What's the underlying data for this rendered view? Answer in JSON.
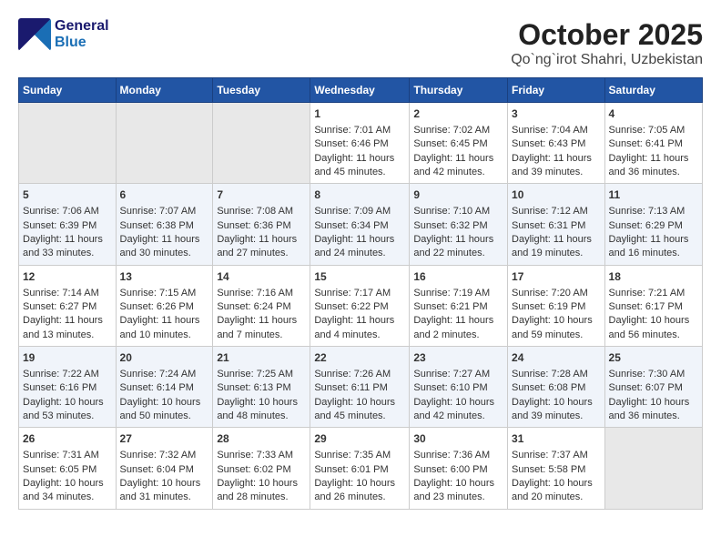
{
  "header": {
    "logo_general": "General",
    "logo_blue": "Blue",
    "title": "October 2025",
    "subtitle": "Qo`ng`irot Shahri, Uzbekistan"
  },
  "days_of_week": [
    "Sunday",
    "Monday",
    "Tuesday",
    "Wednesday",
    "Thursday",
    "Friday",
    "Saturday"
  ],
  "weeks": [
    [
      {
        "day": "",
        "empty": true
      },
      {
        "day": "",
        "empty": true
      },
      {
        "day": "",
        "empty": true
      },
      {
        "day": "1",
        "sunrise": "7:01 AM",
        "sunset": "6:46 PM",
        "daylight": "11 hours and 45 minutes."
      },
      {
        "day": "2",
        "sunrise": "7:02 AM",
        "sunset": "6:45 PM",
        "daylight": "11 hours and 42 minutes."
      },
      {
        "day": "3",
        "sunrise": "7:04 AM",
        "sunset": "6:43 PM",
        "daylight": "11 hours and 39 minutes."
      },
      {
        "day": "4",
        "sunrise": "7:05 AM",
        "sunset": "6:41 PM",
        "daylight": "11 hours and 36 minutes."
      }
    ],
    [
      {
        "day": "5",
        "sunrise": "7:06 AM",
        "sunset": "6:39 PM",
        "daylight": "11 hours and 33 minutes."
      },
      {
        "day": "6",
        "sunrise": "7:07 AM",
        "sunset": "6:38 PM",
        "daylight": "11 hours and 30 minutes."
      },
      {
        "day": "7",
        "sunrise": "7:08 AM",
        "sunset": "6:36 PM",
        "daylight": "11 hours and 27 minutes."
      },
      {
        "day": "8",
        "sunrise": "7:09 AM",
        "sunset": "6:34 PM",
        "daylight": "11 hours and 24 minutes."
      },
      {
        "day": "9",
        "sunrise": "7:10 AM",
        "sunset": "6:32 PM",
        "daylight": "11 hours and 22 minutes."
      },
      {
        "day": "10",
        "sunrise": "7:12 AM",
        "sunset": "6:31 PM",
        "daylight": "11 hours and 19 minutes."
      },
      {
        "day": "11",
        "sunrise": "7:13 AM",
        "sunset": "6:29 PM",
        "daylight": "11 hours and 16 minutes."
      }
    ],
    [
      {
        "day": "12",
        "sunrise": "7:14 AM",
        "sunset": "6:27 PM",
        "daylight": "11 hours and 13 minutes."
      },
      {
        "day": "13",
        "sunrise": "7:15 AM",
        "sunset": "6:26 PM",
        "daylight": "11 hours and 10 minutes."
      },
      {
        "day": "14",
        "sunrise": "7:16 AM",
        "sunset": "6:24 PM",
        "daylight": "11 hours and 7 minutes."
      },
      {
        "day": "15",
        "sunrise": "7:17 AM",
        "sunset": "6:22 PM",
        "daylight": "11 hours and 4 minutes."
      },
      {
        "day": "16",
        "sunrise": "7:19 AM",
        "sunset": "6:21 PM",
        "daylight": "11 hours and 2 minutes."
      },
      {
        "day": "17",
        "sunrise": "7:20 AM",
        "sunset": "6:19 PM",
        "daylight": "10 hours and 59 minutes."
      },
      {
        "day": "18",
        "sunrise": "7:21 AM",
        "sunset": "6:17 PM",
        "daylight": "10 hours and 56 minutes."
      }
    ],
    [
      {
        "day": "19",
        "sunrise": "7:22 AM",
        "sunset": "6:16 PM",
        "daylight": "10 hours and 53 minutes."
      },
      {
        "day": "20",
        "sunrise": "7:24 AM",
        "sunset": "6:14 PM",
        "daylight": "10 hours and 50 minutes."
      },
      {
        "day": "21",
        "sunrise": "7:25 AM",
        "sunset": "6:13 PM",
        "daylight": "10 hours and 48 minutes."
      },
      {
        "day": "22",
        "sunrise": "7:26 AM",
        "sunset": "6:11 PM",
        "daylight": "10 hours and 45 minutes."
      },
      {
        "day": "23",
        "sunrise": "7:27 AM",
        "sunset": "6:10 PM",
        "daylight": "10 hours and 42 minutes."
      },
      {
        "day": "24",
        "sunrise": "7:28 AM",
        "sunset": "6:08 PM",
        "daylight": "10 hours and 39 minutes."
      },
      {
        "day": "25",
        "sunrise": "7:30 AM",
        "sunset": "6:07 PM",
        "daylight": "10 hours and 36 minutes."
      }
    ],
    [
      {
        "day": "26",
        "sunrise": "7:31 AM",
        "sunset": "6:05 PM",
        "daylight": "10 hours and 34 minutes."
      },
      {
        "day": "27",
        "sunrise": "7:32 AM",
        "sunset": "6:04 PM",
        "daylight": "10 hours and 31 minutes."
      },
      {
        "day": "28",
        "sunrise": "7:33 AM",
        "sunset": "6:02 PM",
        "daylight": "10 hours and 28 minutes."
      },
      {
        "day": "29",
        "sunrise": "7:35 AM",
        "sunset": "6:01 PM",
        "daylight": "10 hours and 26 minutes."
      },
      {
        "day": "30",
        "sunrise": "7:36 AM",
        "sunset": "6:00 PM",
        "daylight": "10 hours and 23 minutes."
      },
      {
        "day": "31",
        "sunrise": "7:37 AM",
        "sunset": "5:58 PM",
        "daylight": "10 hours and 20 minutes."
      },
      {
        "day": "",
        "empty": true
      }
    ]
  ],
  "labels": {
    "sunrise": "Sunrise:",
    "sunset": "Sunset:",
    "daylight": "Daylight:"
  }
}
